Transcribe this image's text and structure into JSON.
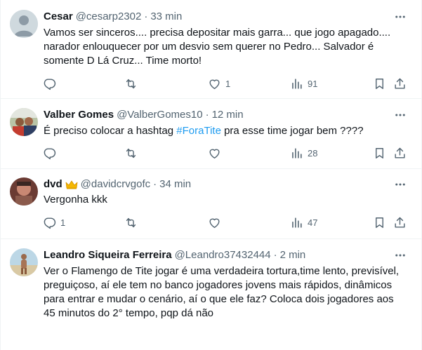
{
  "tweets": [
    {
      "name": "Cesar",
      "handle": "@cesarp2302",
      "separator": "·",
      "time": "33 min",
      "text": "Vamos ser sinceros.... precisa depositar mais garra... que jogo apagado....\nnarador enlouquecer por um desvio sem querer no Pedro... Salvador é\nsomente D Lá Cruz... Time morto!",
      "replies": "",
      "retweets": "",
      "likes": "1",
      "views": "91"
    },
    {
      "name": "Valber Gomes",
      "handle": "@ValberGomes10",
      "separator": "·",
      "time": "12 min",
      "text_before": "É preciso colocar a hashtag ",
      "hashtag": "#ForaTite",
      "text_after": " pra esse time jogar bem ????",
      "replies": "",
      "retweets": "",
      "likes": "",
      "views": "28"
    },
    {
      "name": "dvd",
      "badge": "crown-emoji",
      "handle": "@davidcrvgofc",
      "separator": "·",
      "time": "34 min",
      "text": "Vergonha kkk",
      "replies": "1",
      "retweets": "",
      "likes": "",
      "views": "47"
    },
    {
      "name": "Leandro Siqueira Ferreira",
      "handle": "@Leandro37432444",
      "separator": "·",
      "time": "2 min",
      "text": "Ver o Flamengo de Tite jogar é uma verdadeira tortura,time lento, previsível,\npreguiçoso, aí ele tem no banco jogadores jovens mais rápidos, dinâmicos\npara entrar e mudar o cenário, aí o que ele faz? Coloca dois jogadores aos\n45 minutos do 2° tempo, pqp dá não"
    }
  ],
  "colors": {
    "text": "#0f1419",
    "secondary": "#536471",
    "accent": "#1d9bf0",
    "divider": "#eff3f4"
  },
  "icons": [
    "more-icon",
    "reply-icon",
    "retweet-icon",
    "like-icon",
    "views-icon",
    "bookmark-icon",
    "share-icon"
  ]
}
